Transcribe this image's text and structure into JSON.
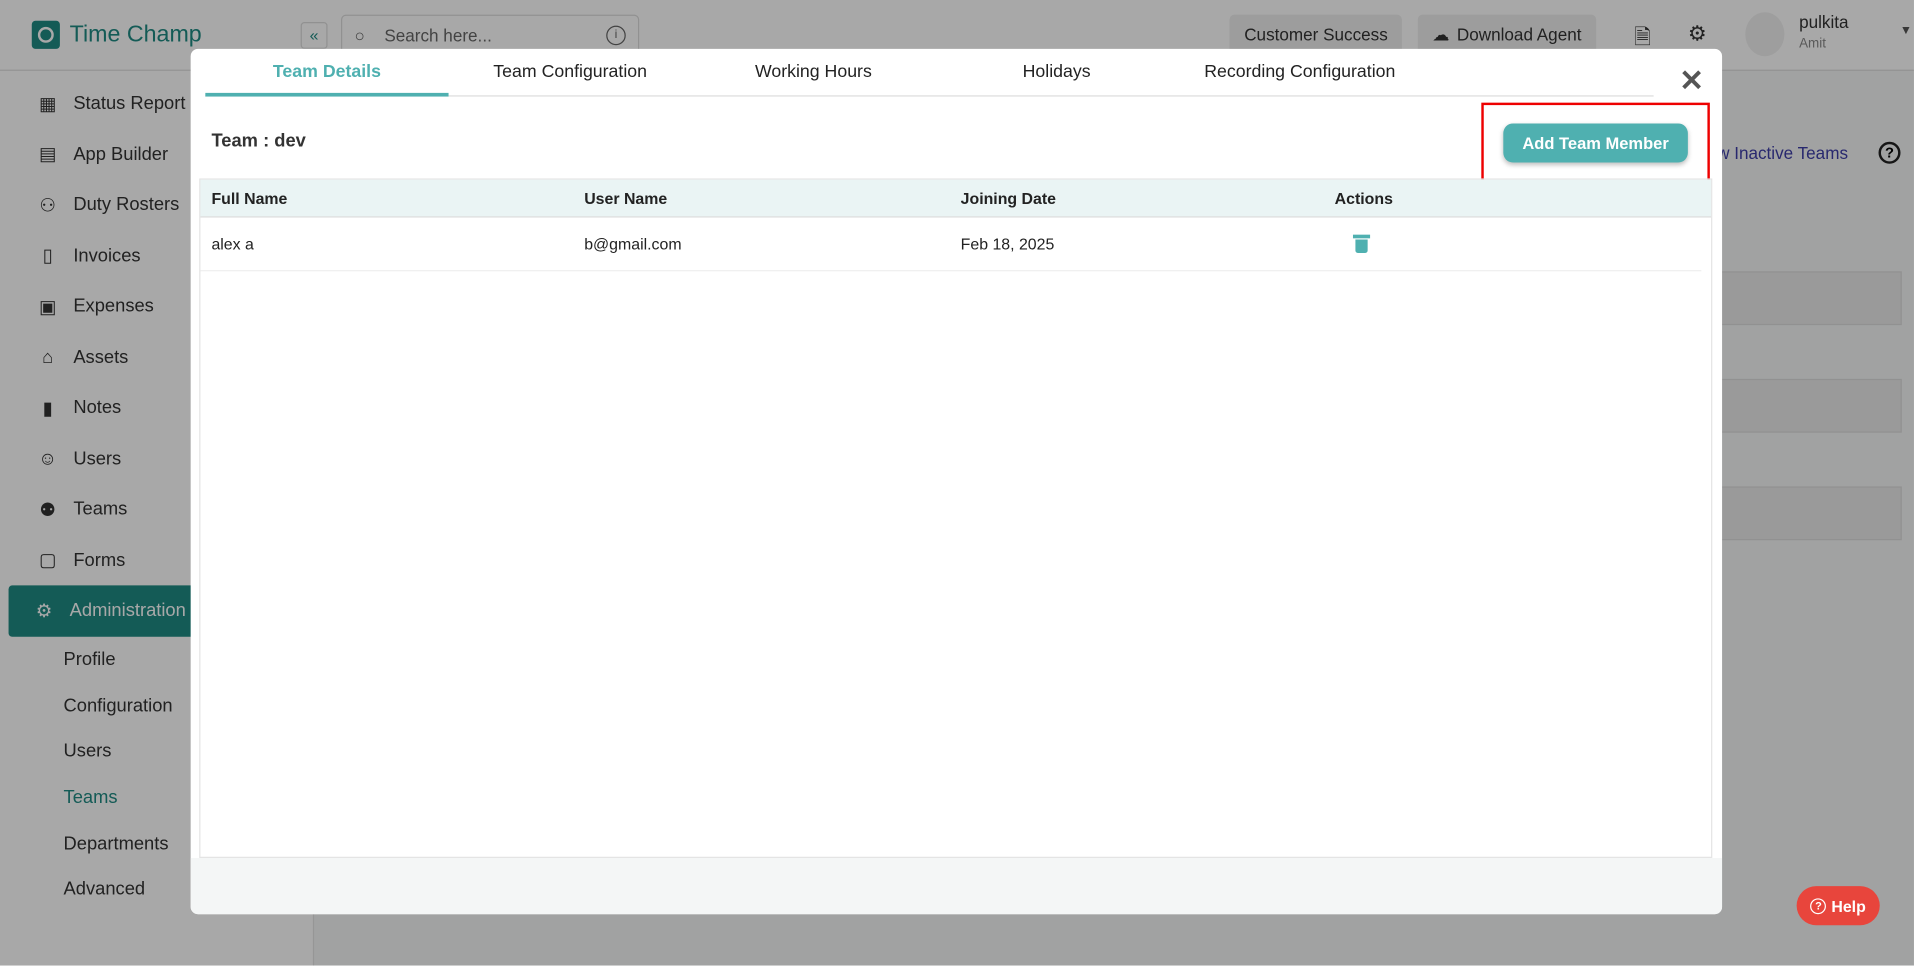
{
  "app": {
    "title": "Time Champ",
    "search_placeholder": "Search here...",
    "customer_success": "Customer Success",
    "download_agent": "Download Agent",
    "user_name": "pulkita",
    "user_sub": "Amit"
  },
  "sidebar": {
    "items": [
      {
        "label": "Status Report",
        "icon": "▦"
      },
      {
        "label": "App Builder",
        "icon": "▤"
      },
      {
        "label": "Duty Rosters",
        "icon": "⚇"
      },
      {
        "label": "Invoices",
        "icon": "▯"
      },
      {
        "label": "Expenses",
        "icon": "▣"
      },
      {
        "label": "Assets",
        "icon": "⌂"
      },
      {
        "label": "Notes",
        "icon": "▮"
      },
      {
        "label": "Users",
        "icon": "☺"
      },
      {
        "label": "Teams",
        "icon": "⚉"
      },
      {
        "label": "Forms",
        "icon": "▢"
      },
      {
        "label": "Administration",
        "icon": "⚙"
      }
    ],
    "sub": [
      "Profile",
      "Configuration",
      "Users",
      "Teams",
      "Departments",
      "Advanced"
    ]
  },
  "page": {
    "inactive_link": "Show Inactive Teams",
    "help": "Help"
  },
  "modal": {
    "tabs": [
      "Team Details",
      "Team Configuration",
      "Working Hours",
      "Holidays",
      "Recording Configuration"
    ],
    "team_label": "Team : dev",
    "add_button": "Add Team Member",
    "columns": [
      "Full Name",
      "User Name",
      "Joining Date",
      "Actions"
    ],
    "rows": [
      {
        "full_name": "alex a",
        "user_name": "b@gmail.com",
        "joining_date": "Feb 18, 2025"
      }
    ]
  }
}
